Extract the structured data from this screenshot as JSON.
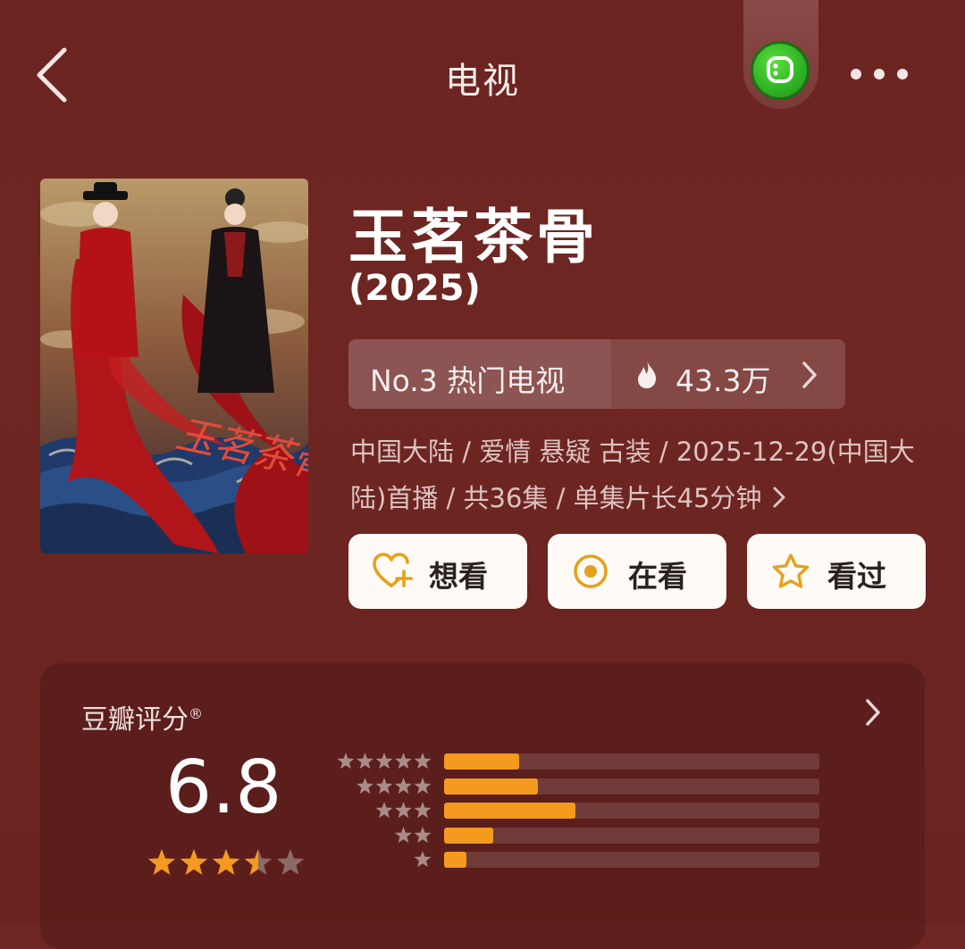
{
  "header": {
    "title": "电视",
    "back_icon": "chevron-left-icon",
    "miniprogram_icon": "green-smile-icon",
    "more_icon": "ellipsis-icon"
  },
  "show": {
    "poster_calligraphy": "玉茗茶骨",
    "name": "玉茗茶骨",
    "year": "(2025)",
    "rank": "No.3 热门电视",
    "heat": "43.3万",
    "meta": "中国大陆 / 爱情 悬疑 古装 / 2025-12-29(中国大陆)首播 / 共36集 / 单集片长45分钟"
  },
  "actions": {
    "want": {
      "label": "想看",
      "icon": "heart-plus-icon"
    },
    "watching": {
      "label": "在看",
      "icon": "target-circle-icon"
    },
    "watched": {
      "label": "看过",
      "icon": "star-outline-icon"
    }
  },
  "rating": {
    "title": "豆瓣评分",
    "registered_mark": "®",
    "score": "6.8",
    "stars_filled": 3.5,
    "stars_total": 5,
    "distribution": [
      {
        "stars": 5,
        "fraction": 0.2
      },
      {
        "stars": 4,
        "fraction": 0.25
      },
      {
        "stars": 3,
        "fraction": 0.35
      },
      {
        "stars": 2,
        "fraction": 0.13
      },
      {
        "stars": 1,
        "fraction": 0.06
      }
    ]
  },
  "colors": {
    "background": "#6e2623",
    "accent_orange": "#f39a1f",
    "icon_gold": "#e4a21c",
    "button_bg": "#fffaf6"
  }
}
